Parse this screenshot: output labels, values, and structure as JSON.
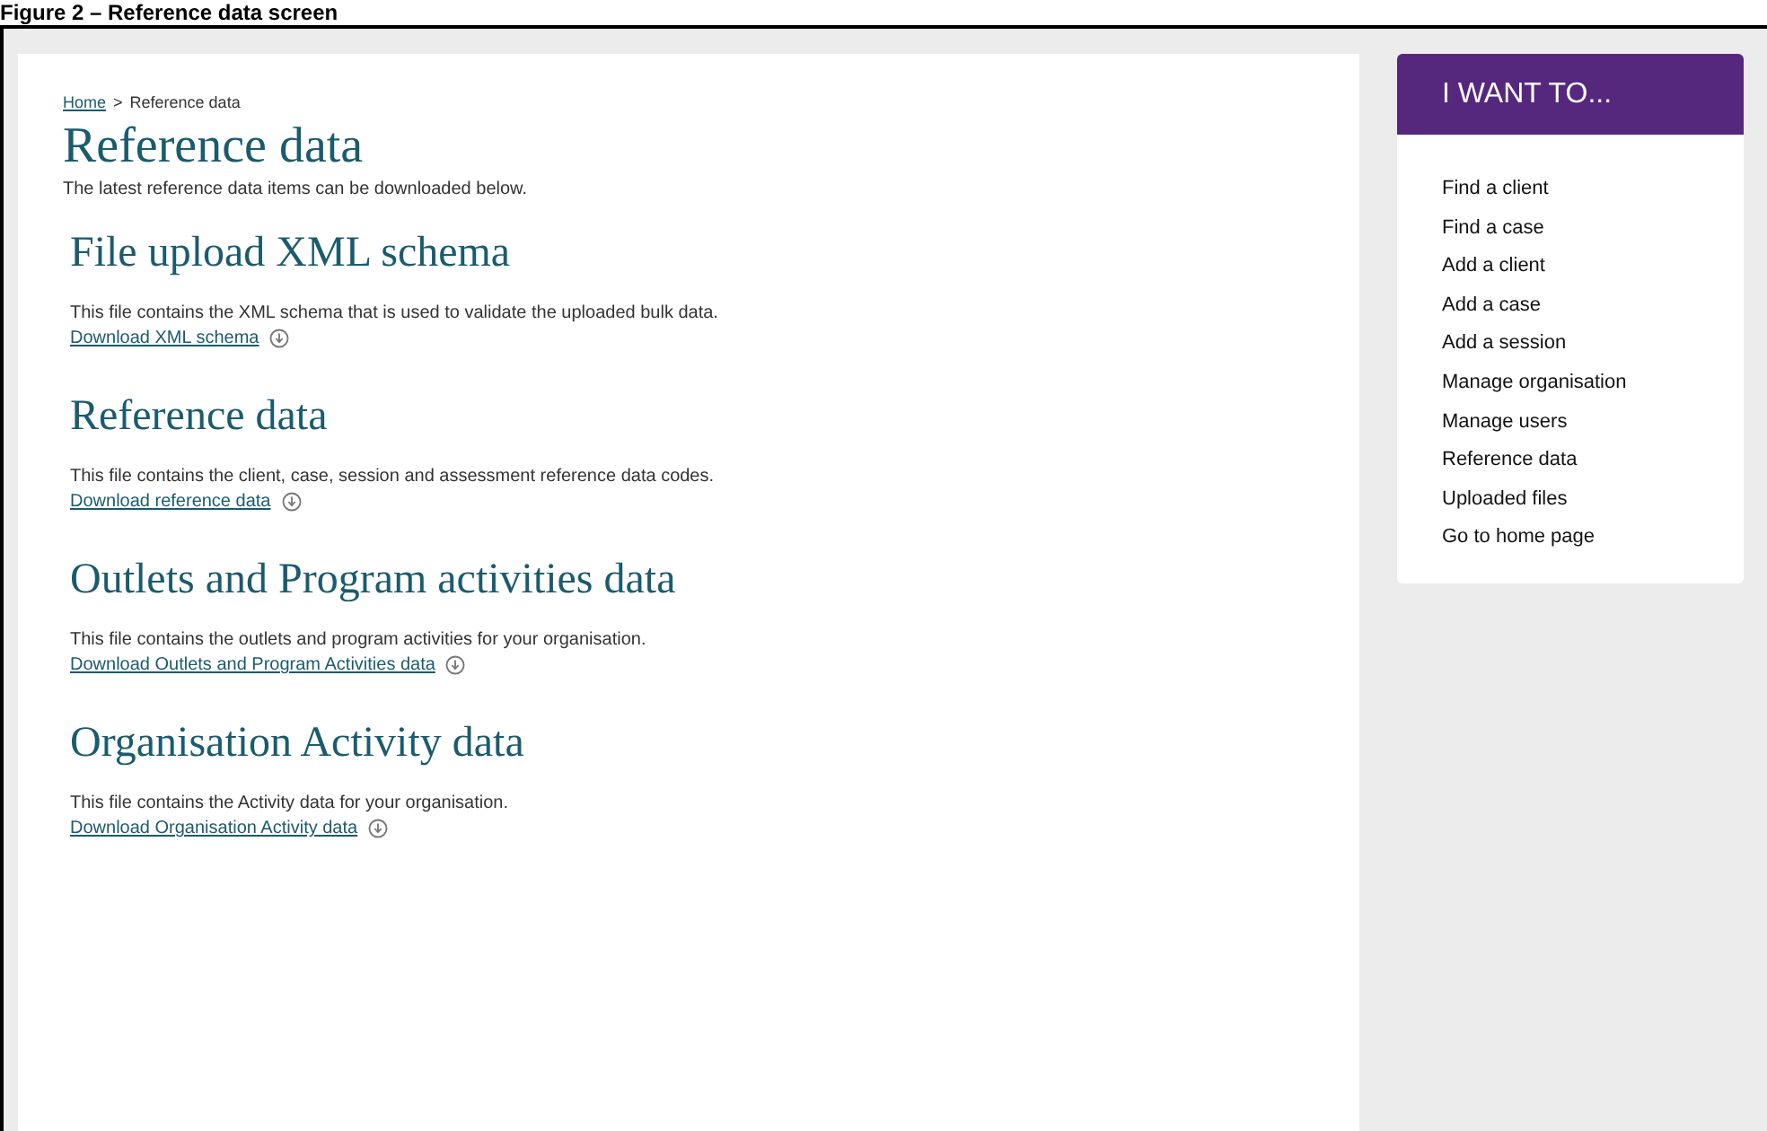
{
  "caption": "Figure 2 – Reference data screen",
  "breadcrumb": {
    "home": "Home",
    "separator": ">",
    "current": "Reference data"
  },
  "title": "Reference data",
  "intro": "The latest reference data items can be downloaded below.",
  "sections": [
    {
      "heading": "File upload XML schema",
      "text": "This file contains the XML schema that is used to validate the uploaded bulk data.",
      "link": "Download XML schema"
    },
    {
      "heading": "Reference data",
      "text": "This file contains the client, case, session and assessment reference data codes.",
      "link": "Download reference data"
    },
    {
      "heading": "Outlets and Program activities data",
      "text": "This file contains the outlets and program activities for your organisation.",
      "link": "Download Outlets and Program Activities data"
    },
    {
      "heading": "Organisation Activity data",
      "text": "This file contains the Activity data for your organisation.",
      "link": "Download Organisation Activity data"
    }
  ],
  "sidebar": {
    "title": "I WANT TO...",
    "items": [
      "Find a client",
      "Find a case",
      "Add a client",
      "Add a case",
      "Add a session",
      "Manage organisation",
      "Manage users",
      "Reference data",
      "Uploaded files",
      "Go to home page"
    ]
  }
}
